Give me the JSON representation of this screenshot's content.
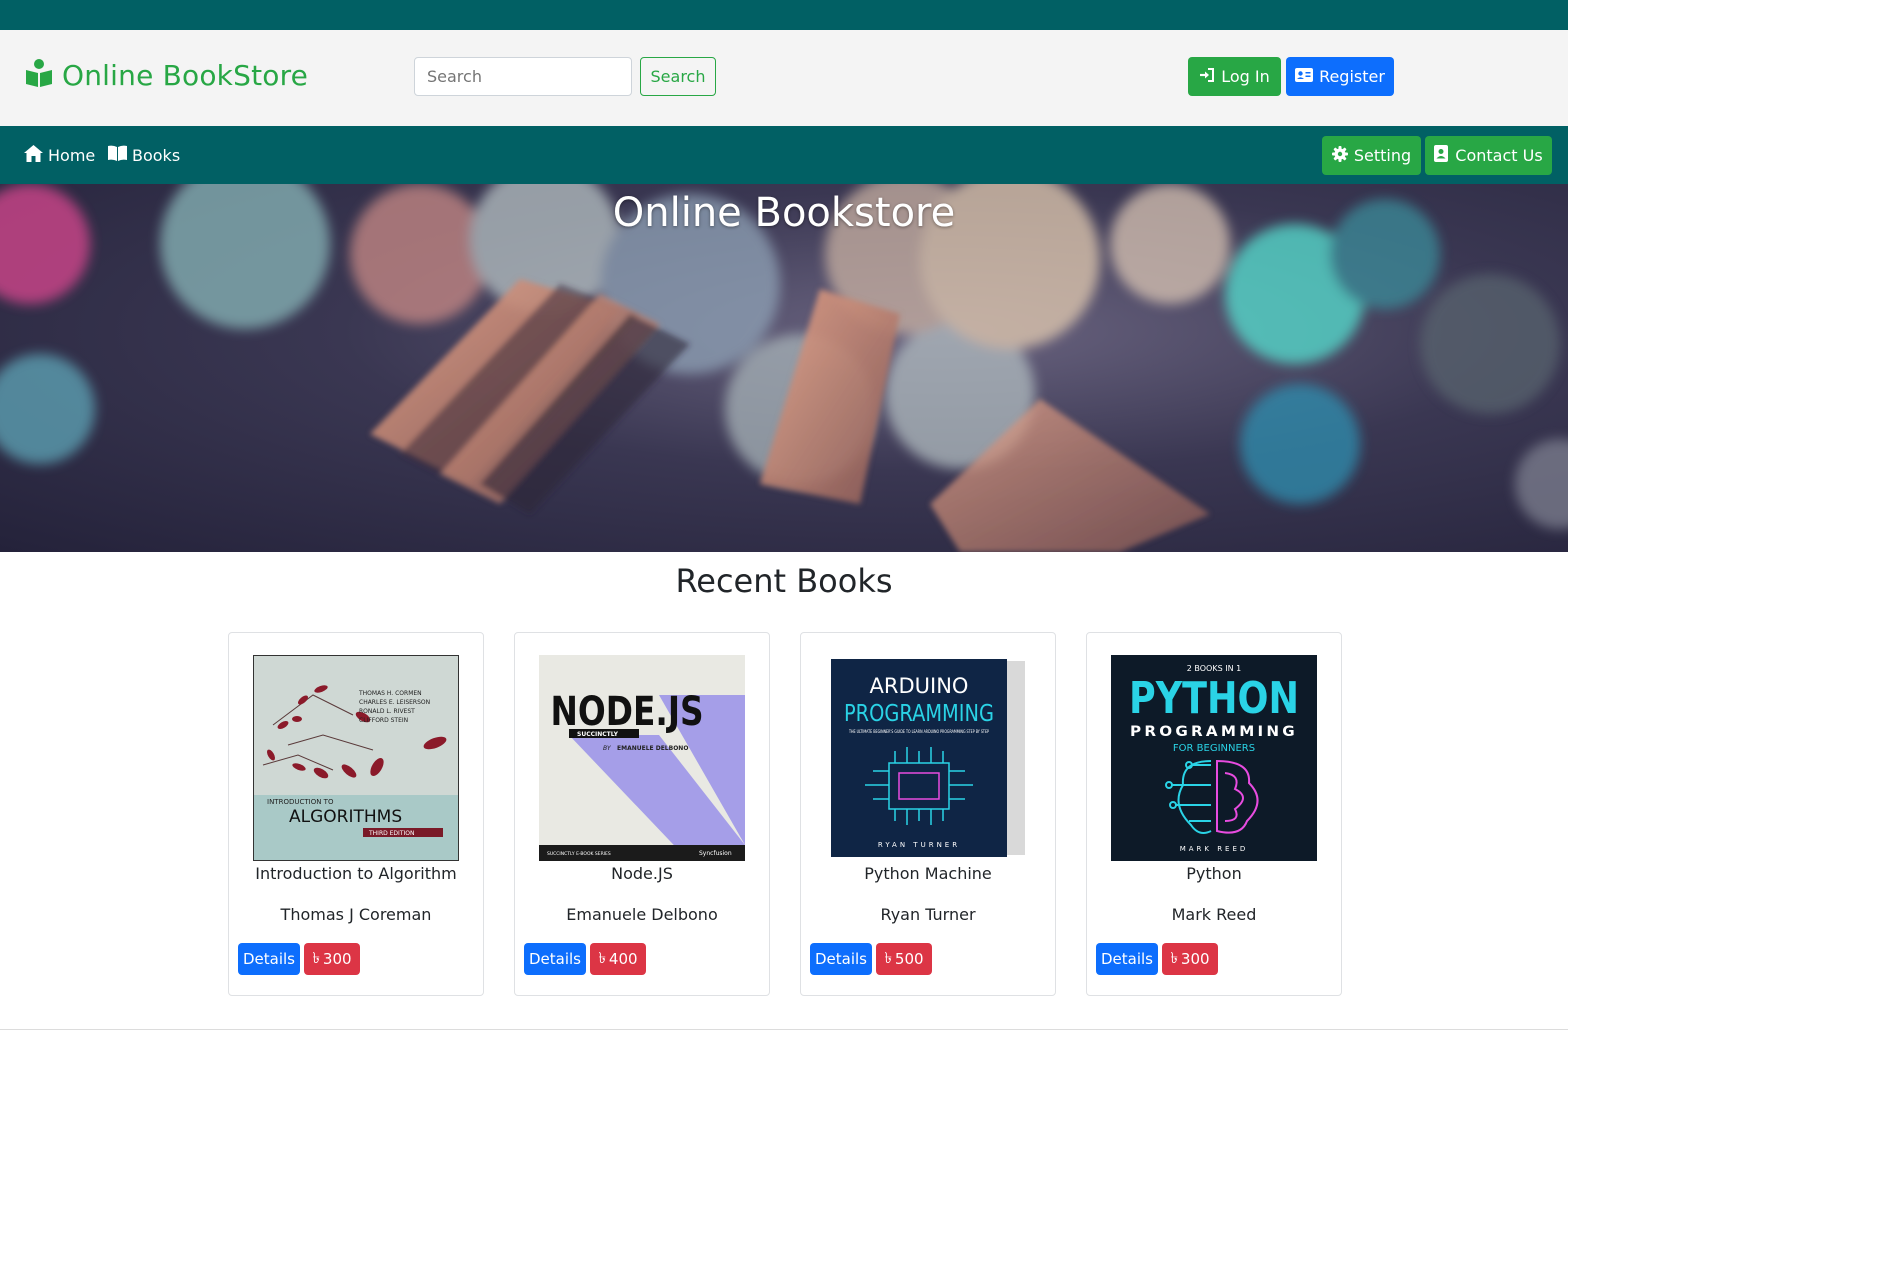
{
  "header": {
    "brand": "Online BookStore",
    "search_placeholder": "Search",
    "search_button": "Search",
    "login_label": "Log In",
    "register_label": "Register"
  },
  "nav": {
    "home": "Home",
    "books": "Books",
    "setting": "Setting",
    "contact": "Contact Us"
  },
  "hero": {
    "title": "Online Bookstore"
  },
  "recent": {
    "title": "Recent Books",
    "details_label": "Details",
    "currency_symbol": "৳",
    "books": [
      {
        "title": "Introduction to Algorithm",
        "author": "Thomas J Coreman",
        "price": "300"
      },
      {
        "title": "Node.JS",
        "author": "Emanuele Delbono",
        "price": "400"
      },
      {
        "title": "Python Machine",
        "author": "Ryan Turner",
        "price": "500"
      },
      {
        "title": "Python",
        "author": "Mark Reed",
        "price": "300"
      }
    ]
  },
  "covers": {
    "algorithms": {
      "authors": [
        "THOMAS H. CORMEN",
        "CHARLES E. LEISERSON",
        "RONALD L. RIVEST",
        "CLIFFORD STEIN"
      ],
      "intro": "INTRODUCTION TO",
      "title": "ALGORITHMS",
      "edition": "THIRD EDITION"
    },
    "nodejs": {
      "title": "NODE.JS",
      "subtitle": "SUCCINCTLY",
      "by": "BY",
      "author": "EMANUELE DELBONO",
      "series": "SUCCINCTLY E-BOOK SERIES",
      "publisher": "Syncfusion"
    },
    "arduino": {
      "title1": "ARDUINO",
      "title2": "PROGRAMMING",
      "tagline": "THE ULTIMATE BEGINNER'S GUIDE TO LEARN ARDUINO PROGRAMMING STEP BY STEP",
      "author": "RYAN TURNER"
    },
    "python": {
      "top": "2 BOOKS IN 1",
      "title": "PYTHON",
      "sub": "PROGRAMMING",
      "sub2": "FOR BEGINNERS",
      "author": "MARK REED"
    }
  },
  "colors": {
    "teal": "#016064",
    "green": "#28a745",
    "blue": "#0d6efd",
    "red": "#dc3545"
  }
}
